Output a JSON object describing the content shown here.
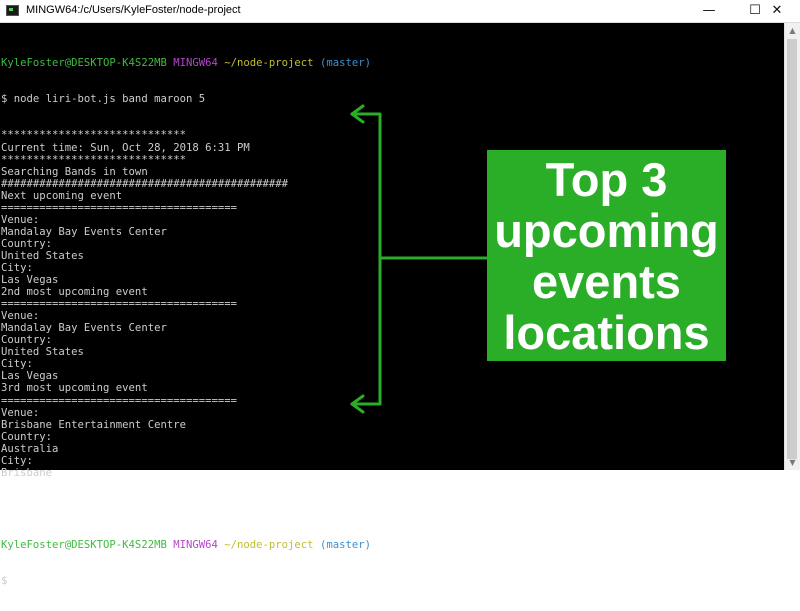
{
  "window": {
    "title": "MINGW64:/c/Users/KyleFoster/node-project",
    "controls": {
      "minimize": "—",
      "maximize": "☐",
      "close": "✕"
    }
  },
  "terminal": {
    "prompt1": {
      "user": "KyleFoster@DESKTOP-K4S22MB",
      "env": "MINGW64",
      "path": "~/node-project",
      "branch": "(master)"
    },
    "command": "$ node liri-bot.js band maroon 5",
    "lines": [
      "*****************************",
      "Current time: Sun, Oct 28, 2018 6:31 PM",
      "*****************************",
      "Searching Bands in town",
      "#############################################",
      "Next upcoming event",
      "=====================================",
      "Venue:",
      "Mandalay Bay Events Center",
      "Country:",
      "United States",
      "City:",
      "Las Vegas",
      "2nd most upcoming event",
      "=====================================",
      "Venue:",
      "Mandalay Bay Events Center",
      "Country:",
      "United States",
      "City:",
      "Las Vegas",
      "3rd most upcoming event",
      "=====================================",
      "Venue:",
      "Brisbane Entertainment Centre",
      "Country:",
      "Australia",
      "City:",
      "Brisbane"
    ],
    "blank": "",
    "prompt2": {
      "user": "KyleFoster@DESKTOP-K4S22MB",
      "env": "MINGW64",
      "path": "~/node-project",
      "branch": "(master)"
    },
    "final_prompt": "$ "
  },
  "annotation": {
    "lines": [
      "Top 3",
      "upcoming",
      "events",
      "locations"
    ],
    "color": "#2aad27"
  }
}
